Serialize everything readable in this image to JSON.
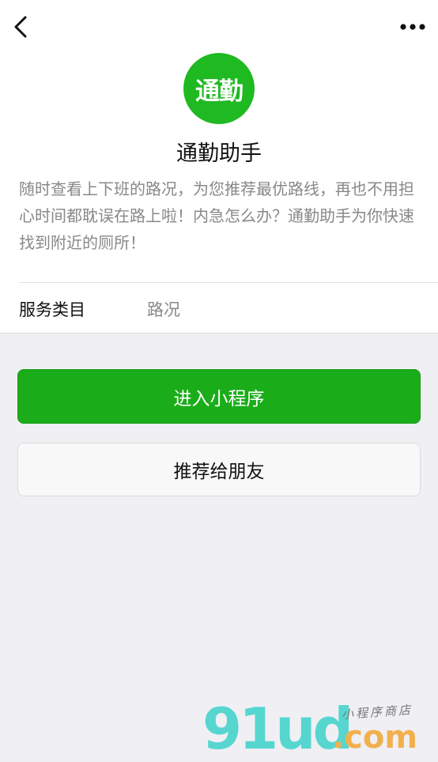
{
  "nav": {
    "back_icon": "chevron-left-icon",
    "more_icon": "more-horizontal-icon"
  },
  "app": {
    "logo_text": "通勤",
    "logo_color": "#1fb922",
    "name": "通勤助手",
    "description": "随时查看上下班的路况，为您推荐最优路线，再也不用担心时间都耽误在路上啦！内急怎么办？通勤助手为你快速找到附近的厕所！"
  },
  "service": {
    "label": "服务类目",
    "value": "路况"
  },
  "buttons": {
    "enter_label": "进入小程序",
    "enter_color": "#1aad19",
    "recommend_label": "推荐给朋友"
  },
  "watermark": {
    "main": "91ud",
    "dotcom": ".com",
    "tagline": "小程序商店"
  }
}
